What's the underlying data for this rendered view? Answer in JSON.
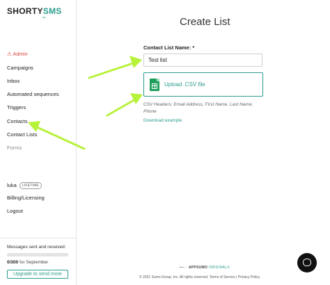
{
  "brand": {
    "logo_main": "SHORTY",
    "logo_accent": "SMS",
    "logo_sub": "by...",
    "accent_color": "#2b9c8c"
  },
  "sidebar": {
    "items": [
      {
        "label": "⚠ Admin"
      },
      {
        "label": "Campaigns"
      },
      {
        "label": "Inbox"
      },
      {
        "label": "Automated sequences"
      },
      {
        "label": "Triggers"
      },
      {
        "label": "Contacts"
      },
      {
        "label": "Contact Lists"
      },
      {
        "label": "Forms"
      }
    ],
    "user": {
      "name": "luka",
      "badge": "LIFETIME"
    },
    "billing_label": "Billing/Licensing",
    "logout_label": "Logout"
  },
  "usage": {
    "label": "Messages sent and received:",
    "count": "0/300",
    "period": "for September",
    "progress_fraction": 0,
    "upgrade_label": "Upgrade to send more"
  },
  "main": {
    "title": "Create List",
    "name_label": "Contact List Name: *",
    "name_value": "Test list",
    "upload_label": "Upload .CSV file",
    "csv_prefix": "CSV Headers: ",
    "csv_headers": "Email Address, First Name, Last Name, Phone",
    "download_label": "Download example"
  },
  "footer": {
    "brand_prefix": "⟵ ·",
    "brand_name": "APPSUMO",
    "brand_suffix": "ORIGINALS",
    "copyright": "© 2021 Sumo Group, Inc. All rights reserved. Terms of Service | Privacy Policy."
  },
  "icons": {
    "sheet": "google-sheets-icon",
    "chat": "chat-bubble-icon",
    "annotation": "arrow-annotation"
  },
  "colors": {
    "annotation_arrow": "#b7f23a",
    "admin": "#d9443b",
    "sheet_green": "#1e9e5b"
  }
}
